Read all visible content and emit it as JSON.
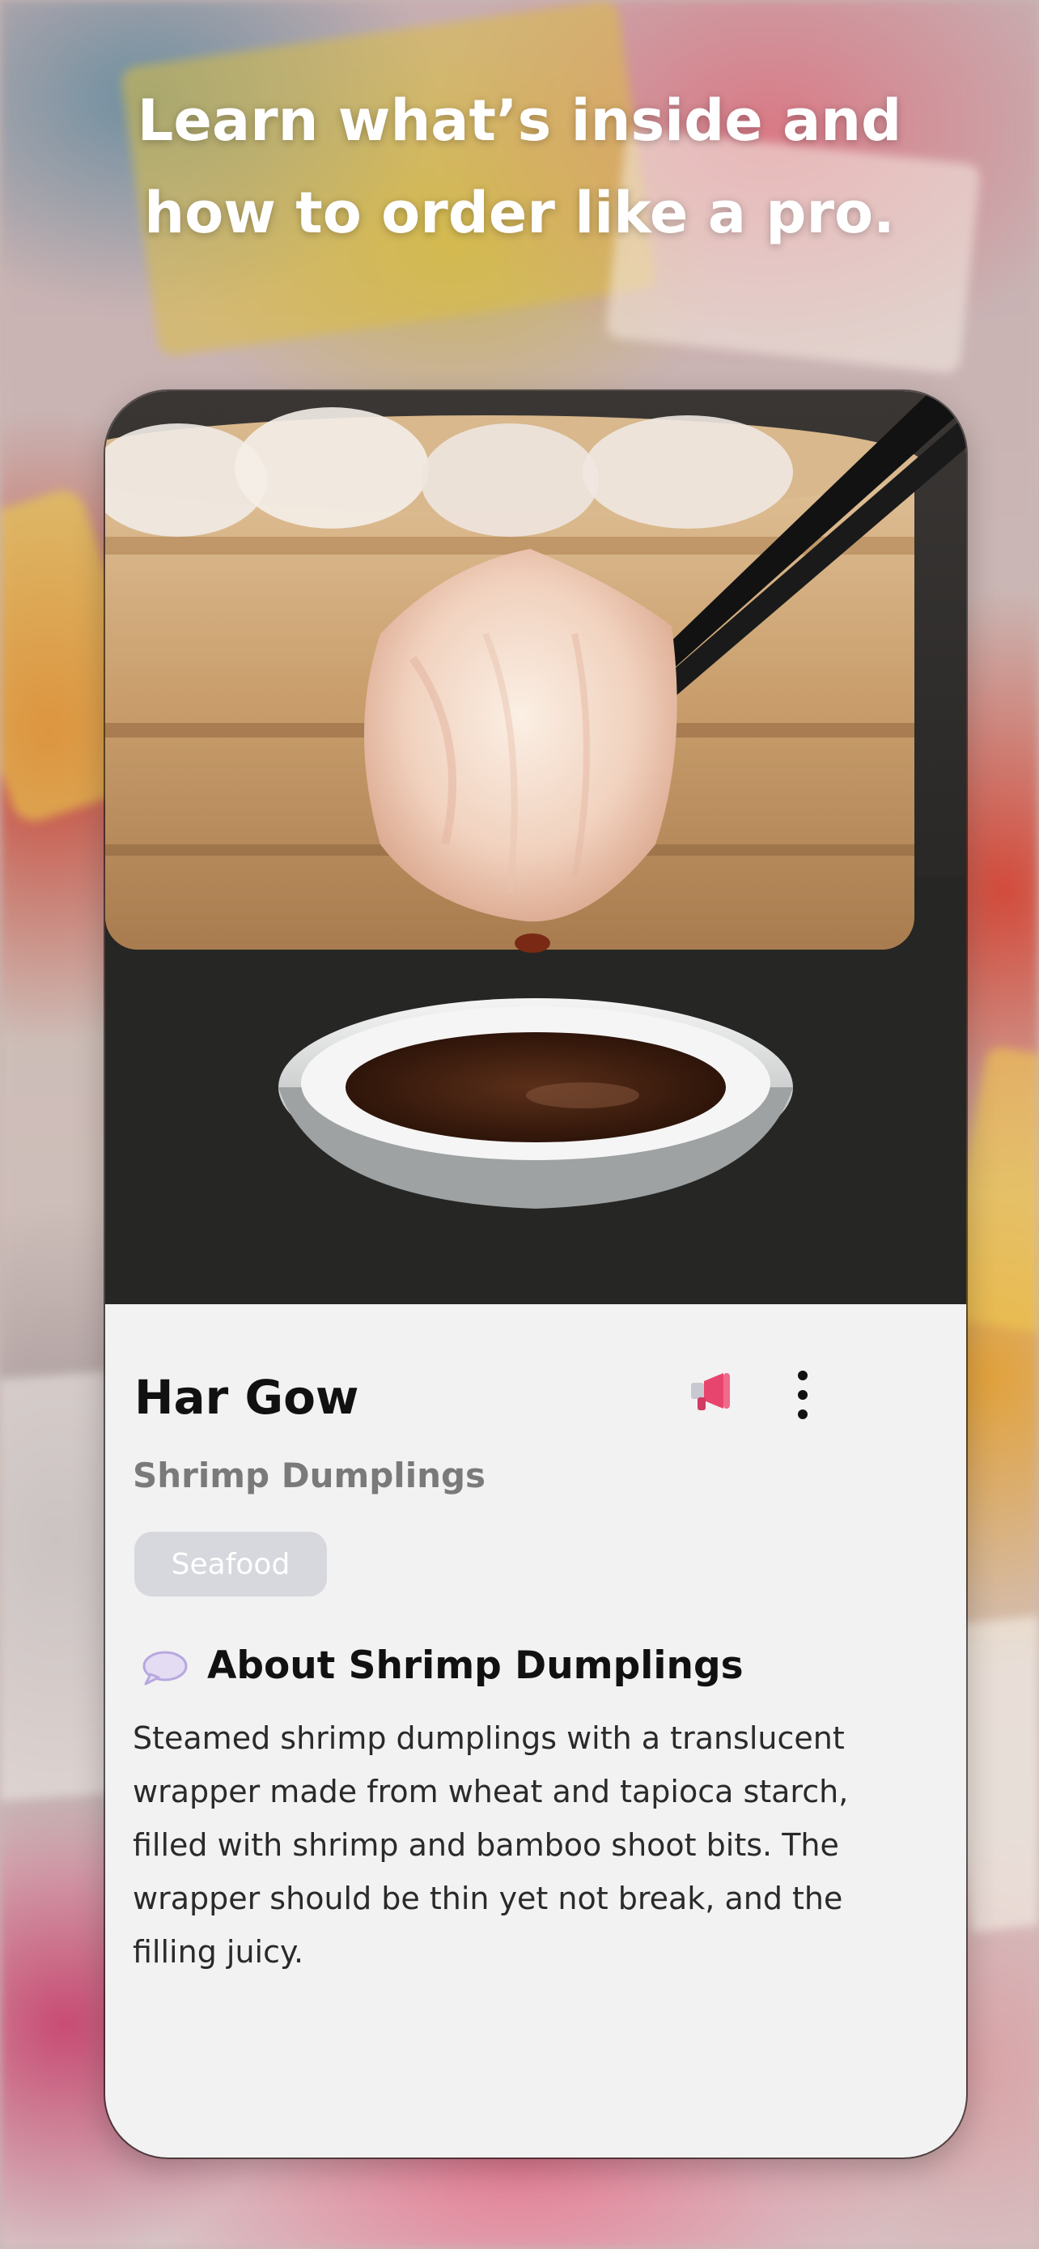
{
  "headline": {
    "lines": [
      "Learn what’s inside and",
      "how to order like a pro."
    ]
  },
  "card": {
    "photo_alt": "Har Gow dumpling held by chopsticks over soy sauce",
    "title": "Har Gow",
    "subtitle": "Shrimp Dumplings",
    "tag": "Seafood",
    "announce_icon": "megaphone-icon",
    "more_icon": "more-vertical-icon",
    "about": {
      "icon": "speech-bubble-icon",
      "title": "About Shrimp Dumplings",
      "lines": [
        "Steamed shrimp dumplings with a translucent",
        "wrapper made from wheat and tapioca starch,",
        "filled with shrimp and bamboo shoot bits. The",
        "wrapper should be thin yet not break, and the",
        "filling juicy."
      ]
    }
  },
  "colors": {
    "card_background": "#f2f2f2",
    "tag_background": "#d6d8de",
    "accent_megaphone": "#e8456e"
  }
}
